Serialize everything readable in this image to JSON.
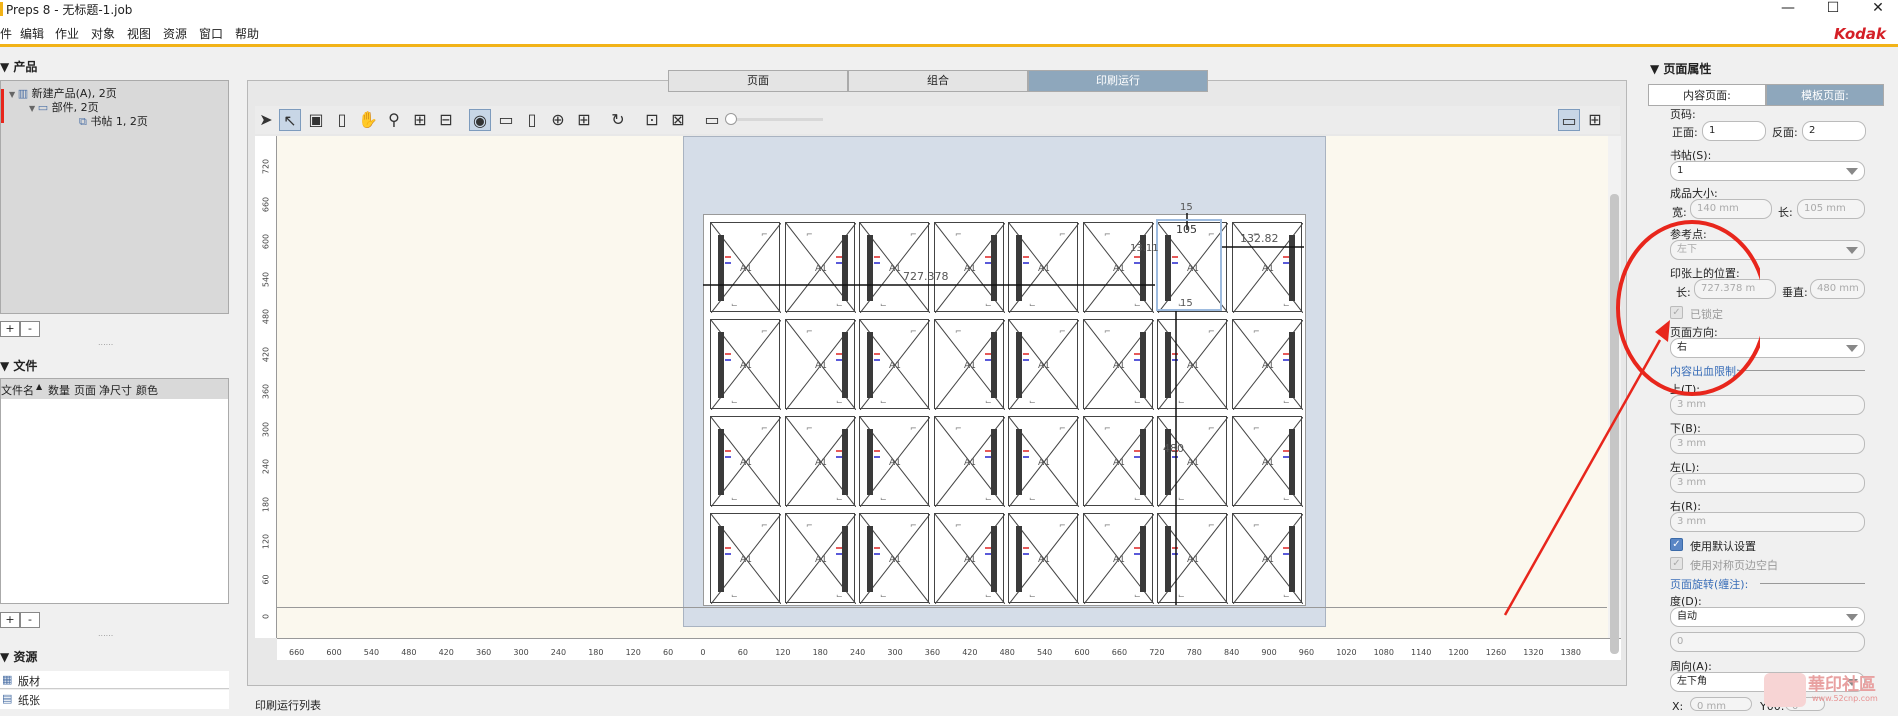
{
  "window": {
    "title": "Preps 8 - 无标题-1.job",
    "minimize": "—",
    "maximize": "☐",
    "close": "✕",
    "brand": "Kodak"
  },
  "menu": [
    "件",
    "编辑",
    "作业",
    "对象",
    "视图",
    "资源",
    "窗口",
    "帮助"
  ],
  "left": {
    "products": {
      "title": "产品",
      "items": [
        "新建产品(A), 2页",
        "部件, 2页",
        "书帖 1, 2页"
      ]
    },
    "files": {
      "title": "文件",
      "columns": [
        "文件名",
        "数量",
        "页面",
        "净尺寸",
        "颜色"
      ]
    },
    "resources": {
      "title": "资源",
      "items": [
        "版材",
        "纸张"
      ]
    },
    "add": "+",
    "remove": "-",
    "dots": "......"
  },
  "tabs": [
    {
      "label": "页面",
      "active": false
    },
    {
      "label": "组合",
      "active": false
    },
    {
      "label": "印刷运行",
      "active": true
    }
  ],
  "bottom_label": "印刷运行列表",
  "rulers": {
    "vertical": [
      "720",
      "660",
      "600",
      "540",
      "480",
      "420",
      "360",
      "300",
      "240",
      "180",
      "120",
      "60",
      "0"
    ],
    "horizontal": [
      "660",
      "600",
      "540",
      "480",
      "420",
      "360",
      "300",
      "240",
      "180",
      "120",
      "60",
      "0",
      "60",
      "120",
      "180",
      "240",
      "300",
      "360",
      "420",
      "480",
      "540",
      "600",
      "660",
      "720",
      "780",
      "840",
      "900",
      "960",
      "1020",
      "1080",
      "1140",
      "1200",
      "1260",
      "1320",
      "1380"
    ]
  },
  "dims": {
    "top": "15",
    "width": "105",
    "left": "13.11",
    "right": "132.82",
    "h": "727.378",
    "bottom": "15",
    "v": "480"
  },
  "cell_label": "A1",
  "right": {
    "title": "页面属性",
    "tabs": [
      "内容页面:",
      "模板页面:"
    ],
    "page_num_label": "页码:",
    "front_label": "正面:",
    "front_value": "1",
    "back_label": "反面:",
    "back_value": "2",
    "signature_label": "书帖(S):",
    "signature_value": "1",
    "trim_label": "成品大小:",
    "width_label": "宽:",
    "width_value": "140 mm",
    "length_label": "长:",
    "length_value": "105 mm",
    "ref_label": "参考点:",
    "ref_value": "左下",
    "pos_label": "印张上的位置:",
    "pos_h_label": "长:",
    "pos_h_value": "727.378 m",
    "pos_v_label": "垂直:",
    "pos_v_value": "480 mm",
    "locked_label": "已锁定",
    "orient_label": "页面方向:",
    "orient_value": "右",
    "bleed_label": "内容出血限制:",
    "top_label": "上(T):",
    "top_value": "3 mm",
    "bottom_label": "下(B):",
    "bottom_value": "3 mm",
    "left_label": "左(L):",
    "left_value": "3 mm",
    "right_label": "右(R):",
    "right_value": "3 mm",
    "default_label": "使用默认设置",
    "gap_label": "使用对称页边空白",
    "rotate_label": "页面旋转(缠注):",
    "degree_label": "度(D):",
    "degree_value": "自动",
    "degree_num": "0",
    "direction_label": "周向(A):",
    "direction_value": "左下角",
    "x_label": "X:",
    "x_value": "0 mm",
    "y_label": "Y00:",
    "y_value": "0",
    "watermark": "華印社區",
    "watermark_url": "www.52cnp.com"
  },
  "colors": {
    "accent": "#f2b318",
    "annotation": "#e8261c",
    "tab_active": "#8ea7bc",
    "brand": "#d41f26"
  }
}
